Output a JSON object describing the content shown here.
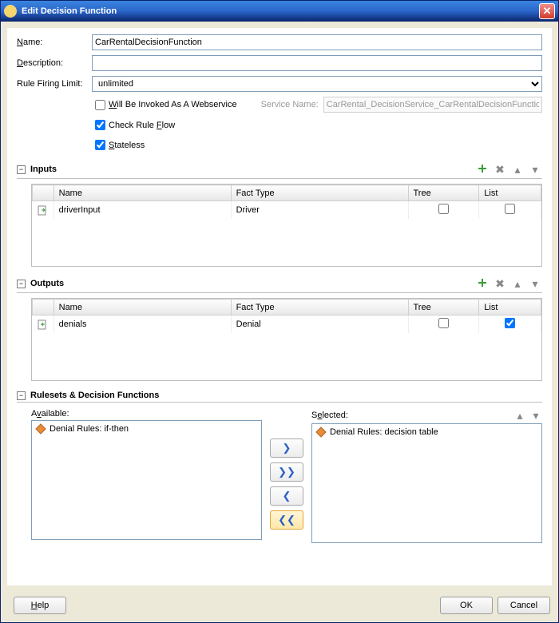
{
  "window": {
    "title": "Edit Decision Function"
  },
  "form": {
    "name_label": "Name:",
    "name_value": "CarRentalDecisionFunction",
    "desc_label": "Description:",
    "desc_value": "",
    "rule_firing_label": "Rule Firing Limit:",
    "rule_firing_value": "unlimited",
    "webservice_label": "Will Be Invoked As A Webservice",
    "webservice_checked": false,
    "service_name_label": "Service Name:",
    "service_name_value": "CarRental_DecisionService_CarRentalDecisionFunction",
    "check_flow_label": "Check Rule Flow",
    "check_flow_checked": true,
    "stateless_label": "Stateless",
    "stateless_checked": true
  },
  "inputs": {
    "title": "Inputs",
    "headers": {
      "name": "Name",
      "fact": "Fact Type",
      "tree": "Tree",
      "list": "List"
    },
    "rows": [
      {
        "name": "driverInput",
        "fact": "Driver",
        "tree": false,
        "list": false
      }
    ]
  },
  "outputs": {
    "title": "Outputs",
    "headers": {
      "name": "Name",
      "fact": "Fact Type",
      "tree": "Tree",
      "list": "List"
    },
    "rows": [
      {
        "name": "denials",
        "fact": "Denial",
        "tree": false,
        "list": true
      }
    ]
  },
  "rulesets": {
    "title": "Rulesets & Decision Functions",
    "available_label": "Available:",
    "selected_label": "Selected:",
    "available": [
      {
        "label": "Denial Rules: if-then"
      }
    ],
    "selected": [
      {
        "label": "Denial Rules: decision table"
      }
    ]
  },
  "footer": {
    "help": "Help",
    "ok": "OK",
    "cancel": "Cancel"
  }
}
